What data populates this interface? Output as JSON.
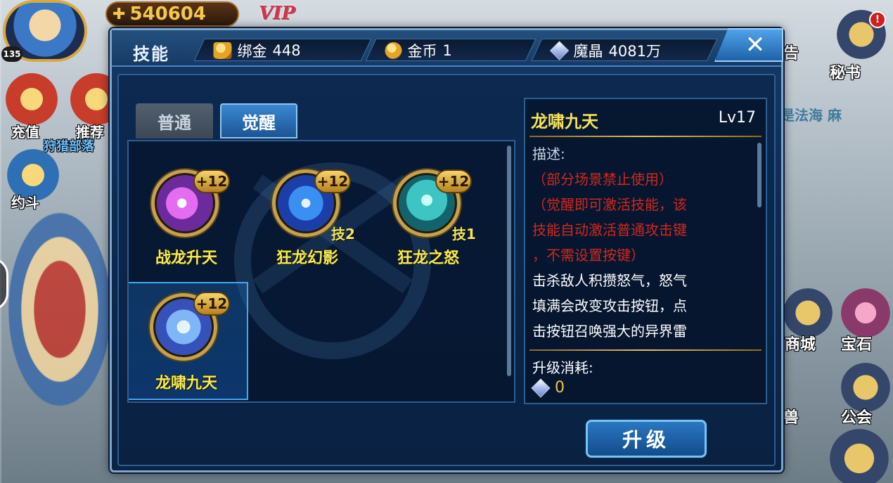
{
  "background_hud": {
    "level": "135",
    "power": "540604",
    "vip_label": "VIP",
    "left_items": [
      "充值",
      "推荐",
      "狩猎部落",
      "约斗"
    ],
    "right_items": [
      "秘书",
      "商城",
      "宝石",
      "公会"
    ],
    "right_partial": [
      "告",
      "兽"
    ],
    "notice_text": "是法海 麻",
    "alert_badge": "!"
  },
  "dialog": {
    "title": "技能",
    "currencies": [
      {
        "name": "绑金",
        "value": "448",
        "icon": "bound-gold-coin-icon"
      },
      {
        "name": "金币",
        "value": "1",
        "icon": "gold-coin-icon"
      },
      {
        "name": "魔晶",
        "value": "4081万",
        "icon": "magic-crystal-icon"
      }
    ],
    "close_label": "✕",
    "tabs": [
      {
        "label": "普通",
        "active": false
      },
      {
        "label": "觉醒",
        "active": true
      }
    ],
    "skills": [
      {
        "name": "战龙升天",
        "level_badge": "+12",
        "tag": "",
        "selected": false
      },
      {
        "name": "狂龙幻影",
        "level_badge": "+12",
        "tag": "技2",
        "selected": false
      },
      {
        "name": "狂龙之怒",
        "level_badge": "+12",
        "tag": "技1",
        "selected": false
      },
      {
        "name": "龙啸九天",
        "level_badge": "+12",
        "tag": "",
        "selected": true
      }
    ],
    "detail": {
      "name": "龙啸九天",
      "level": "Lv17",
      "description_label": "描述:",
      "warning_1": "（部分场景禁止使用）",
      "warning_2": "（觉醒即可激活技能，该",
      "warning_3": "技能自动激活普通攻击键",
      "warning_4": "，不需设置按键）",
      "text_1": "击杀敌人积攒怒气，怒气",
      "text_2": "填满会改变攻击按钮，点",
      "text_3": "击按钮召唤强大的异界雷",
      "cost_label": "升级消耗:",
      "cost_value": "0"
    },
    "upgrade_label": "升级"
  }
}
